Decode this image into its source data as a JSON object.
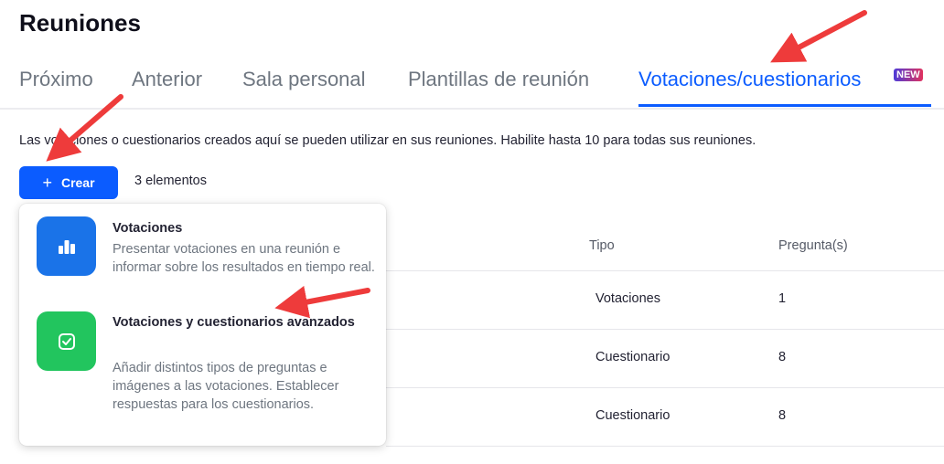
{
  "page_title": "Reuniones",
  "tabs": [
    {
      "label": "Próximo"
    },
    {
      "label": "Anterior"
    },
    {
      "label": "Sala personal"
    },
    {
      "label": "Plantillas de reunión"
    },
    {
      "label": "Votaciones/cuestionarios"
    }
  ],
  "new_badge": "NEW",
  "description": "Las votaciones o cuestionarios creados aquí se pueden utilizar en sus reuniones. Habilite hasta 10 para todas sus reuniones.",
  "create_button": {
    "icon": "+",
    "label": "Crear"
  },
  "item_count": "3 elementos",
  "columns": {
    "tipo": "Tipo",
    "preguntas": "Pregunta(s)"
  },
  "rows": [
    {
      "tipo": "Votaciones",
      "preguntas": "1"
    },
    {
      "tipo": "Cuestionario",
      "preguntas": "8"
    },
    {
      "tipo": "Cuestionario",
      "preguntas": "8"
    }
  ],
  "dropdown": {
    "items": [
      {
        "title": "Votaciones",
        "description": "Presentar votaciones en una reunión e informar sobre los resultados en tiempo real.",
        "icon": "bar-chart-icon",
        "color": "#1a73e8"
      },
      {
        "title": "Votaciones y cuestionarios avanzados",
        "description": "Añadir distintos tipos de preguntas e imágenes a las votaciones. Establecer respuestas para los cuestionarios.",
        "icon": "checkbox-icon",
        "color": "#22c55e"
      }
    ]
  },
  "colors": {
    "accent": "#0b5cff",
    "annotation_arrow": "#ee3b3b"
  }
}
